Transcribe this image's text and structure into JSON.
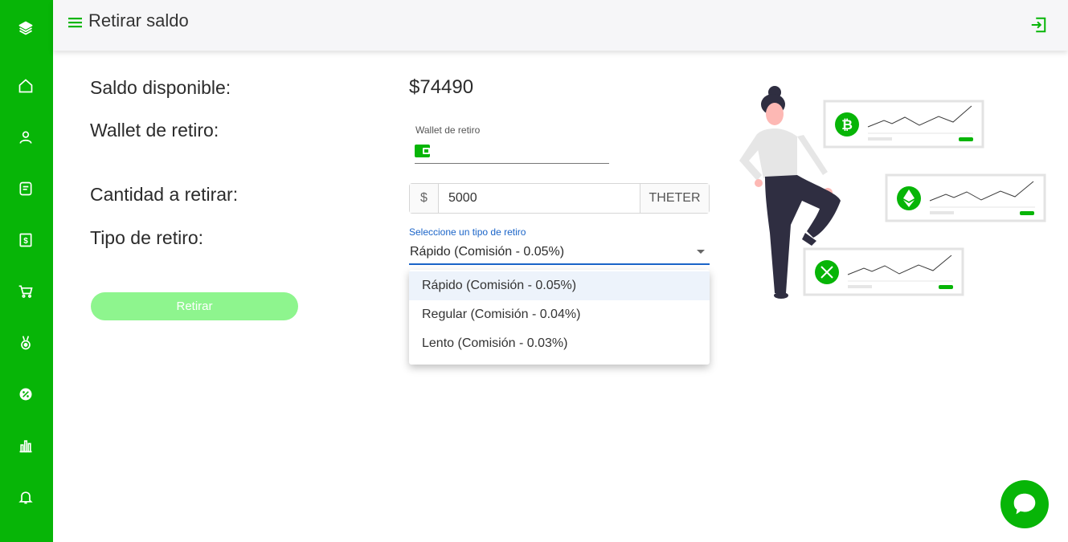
{
  "header": {
    "title": "Retirar saldo"
  },
  "labels": {
    "saldo": "Saldo disponible:",
    "wallet": "Wallet de retiro:",
    "cantidad": "Cantidad a retirar:",
    "tipo": "Tipo de retiro:"
  },
  "balance": "$74490",
  "wallet_field": {
    "label": "Wallet de retiro",
    "value": ""
  },
  "amount": {
    "prefix": "$",
    "value": "5000",
    "suffix": "THETER"
  },
  "withdraw_type": {
    "label": "Seleccione un tipo de retiro",
    "selected": "Rápido (Comisión - 0.05%)",
    "options": [
      "Rápido (Comisión - 0.05%)",
      "Regular (Comisión - 0.04%)",
      "Lento (Comisión - 0.03%)"
    ]
  },
  "submit_label": "Retirar",
  "sidebar": {
    "icons": [
      "layers-icon",
      "home-icon",
      "user-icon",
      "document-icon",
      "dollar-icon",
      "cart-icon",
      "medal-icon",
      "percent-icon",
      "bar-chart-icon",
      "bell-icon"
    ]
  },
  "colors": {
    "brand": "#07b507",
    "accent": "#1a64c8",
    "button": "#8ef58e"
  }
}
